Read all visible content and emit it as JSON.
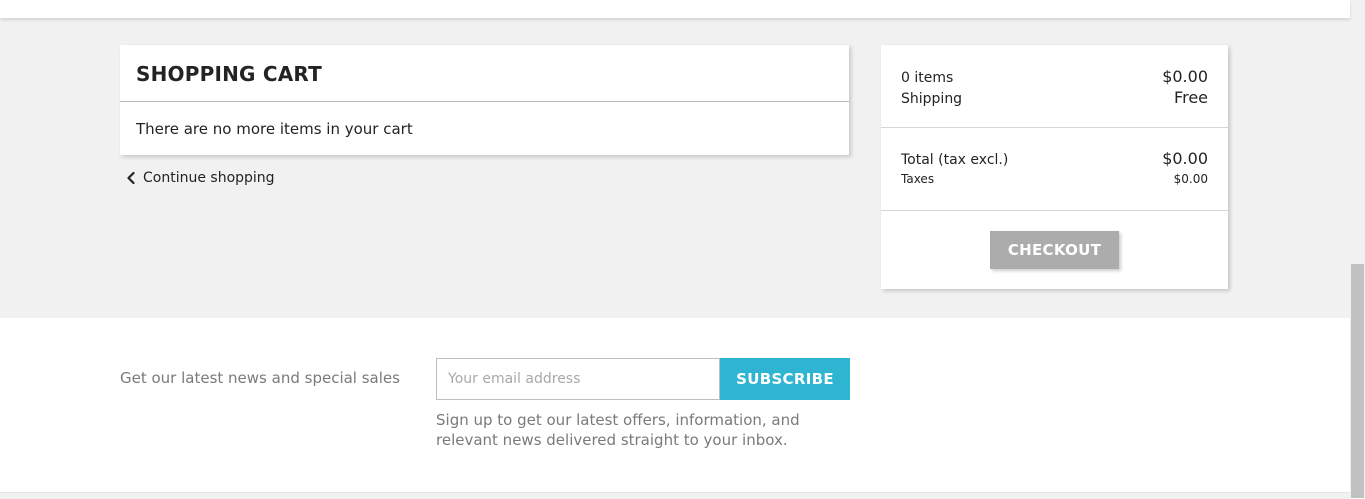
{
  "cart": {
    "title": "SHOPPING CART",
    "empty_message": "There are no more items in your cart",
    "continue_label": "Continue shopping"
  },
  "summary": {
    "items_label": "0 items",
    "items_value": "$0.00",
    "shipping_label": "Shipping",
    "shipping_value": "Free",
    "total_label": "Total (tax excl.)",
    "total_value": "$0.00",
    "taxes_label": "Taxes",
    "taxes_value": "$0.00",
    "checkout_label": "CHECKOUT"
  },
  "newsletter": {
    "label": "Get our latest news and special sales",
    "email_placeholder": "Your email address",
    "email_value": "",
    "subscribe_label": "SUBSCRIBE",
    "note": "Sign up to get our latest offers, information, and relevant news delivered straight to your inbox."
  },
  "colors": {
    "accent": "#2fb5d2",
    "checkout_disabled": "#acacac",
    "page_gray": "#f1f1f1"
  },
  "icons": {
    "continue": "chevron-left-icon"
  }
}
